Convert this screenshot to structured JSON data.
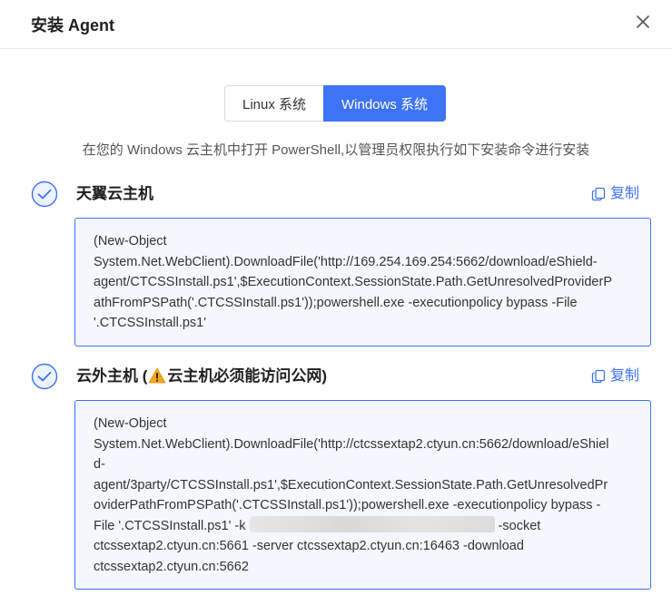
{
  "dialog": {
    "title": "安装 Agent"
  },
  "os_tabs": [
    {
      "label": "Linux 系统",
      "active": false
    },
    {
      "label": "Windows 系统",
      "active": true
    }
  ],
  "instruction": "在您的 Windows 云主机中打开 PowerShell,以管理员权限执行如下安装命令进行安装",
  "sections": [
    {
      "title": "天翼云主机",
      "copy_label": "复制",
      "command_lines": [
        "(New-Object",
        "System.Net.WebClient).DownloadFile('http://169.254.169.254:5662/download/eShield-",
        "agent/CTCSSInstall.ps1',$ExecutionContext.SessionState.Path.GetUnresolvedProviderP",
        "athFromPSPath('.CTCSSInstall.ps1'));powershell.exe -executionpolicy bypass -File",
        "'.CTCSSInstall.ps1'"
      ]
    },
    {
      "title_prefix": "云外主机 (",
      "title_warning": "云主机必须能访问公网)",
      "copy_label": "复制",
      "command_lines": [
        "(New-Object",
        "System.Net.WebClient).DownloadFile('http://ctcssextap2.ctyun.cn:5662/download/eShiel",
        "d-",
        "agent/3party/CTCSSInstall.ps1',$ExecutionContext.SessionState.Path.GetUnresolvedPr",
        "oviderPathFromPSPath('.CTCSSInstall.ps1'));powershell.exe -executionpolicy bypass -"
      ],
      "key_line_prefix": "File '.CTCSSInstall.ps1' -k",
      "key_line_suffix": "-socket",
      "command_tail": [
        "ctcssextap2.ctyun.cn:5661 -server ctcssextap2.ctyun.cn:16463 -download",
        "ctcssextap2.ctyun.cn:5662"
      ]
    }
  ],
  "icons": {
    "close": "close-icon",
    "check": "check-circle-icon",
    "copy": "copy-icon",
    "warning": "warning-icon"
  },
  "colors": {
    "accent": "#3d73f5",
    "code_bg": "#f4f8fe",
    "warning": "#f5a623"
  }
}
